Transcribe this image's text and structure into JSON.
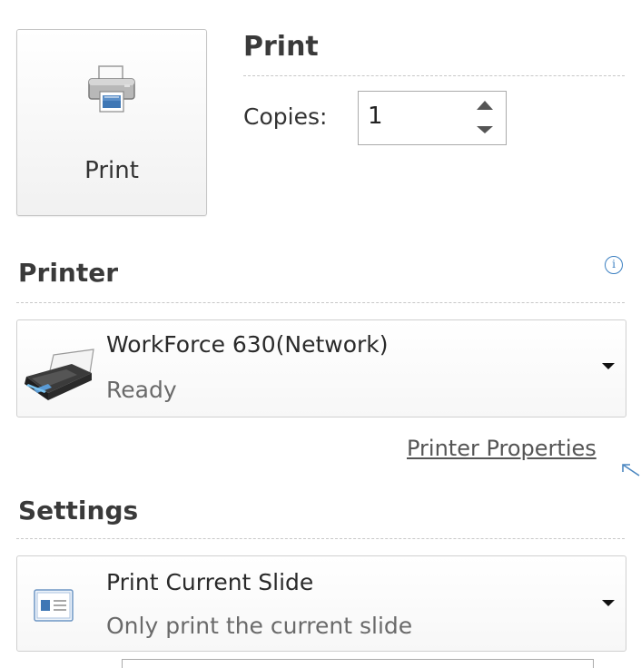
{
  "print_button": {
    "label": "Print",
    "icon": "printer-icon"
  },
  "print_section": {
    "heading": "Print",
    "copies_label": "Copies:",
    "copies_value": "1"
  },
  "printer_section": {
    "heading": "Printer",
    "info_icon": "info-icon",
    "selected": {
      "name": "WorkForce 630(Network)",
      "status": "Ready",
      "icon": "inkjet-printer-icon"
    },
    "properties_link": "Printer Properties"
  },
  "settings_section": {
    "heading": "Settings",
    "slides": {
      "title": "Print Current Slide",
      "description": "Only print the current slide",
      "icon": "slide-icon"
    }
  },
  "colors": {
    "accent_blue": "#3a7fc1",
    "border": "#d0d0d0",
    "text_primary": "#2a2a2a",
    "text_secondary": "#6a6a6a"
  }
}
